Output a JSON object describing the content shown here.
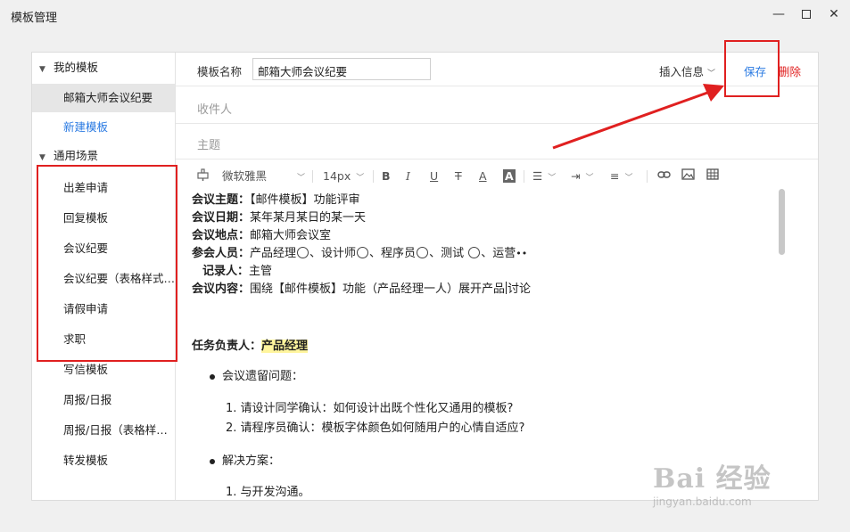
{
  "window": {
    "title": "模板管理"
  },
  "sidebar": {
    "my_templates_header": "我的模板",
    "my_items": [
      {
        "label": "邮箱大师会议纪要"
      },
      {
        "label": "新建模板"
      }
    ],
    "scenes_header": "通用场景",
    "scene_items": [
      {
        "label": "出差申请"
      },
      {
        "label": "回复模板"
      },
      {
        "label": "会议纪要"
      },
      {
        "label": "会议纪要（表格样式…"
      },
      {
        "label": "请假申请"
      },
      {
        "label": "求职"
      },
      {
        "label": "写信模板"
      },
      {
        "label": "周报/日报"
      },
      {
        "label": "周报/日报（表格样…"
      },
      {
        "label": "转发模板"
      }
    ]
  },
  "editor": {
    "name_label": "模板名称",
    "name_value": "邮箱大师会议纪要",
    "insert_label": "插入信息",
    "save_label": "保存",
    "delete_label": "删除",
    "recipient_placeholder": "收件人",
    "subject_placeholder": "主题"
  },
  "toolbar": {
    "font_family": "微软雅黑",
    "font_size": "14px"
  },
  "content": {
    "topic_label": "会议主题：",
    "topic_value": "【邮件模板】功能评审",
    "date_label": "会议日期：",
    "date_value": "某年某月某日的某一天",
    "place_label": "会议地点：",
    "place_value": "邮箱大师会议室",
    "attendees_label": "参会人员：",
    "attendees": [
      "产品经理",
      "、设计师",
      "、程序员",
      "、测试 ",
      "、运营"
    ],
    "recorder_label": "记录人：",
    "recorder_value": "主管",
    "body_label": "会议内容：",
    "body_value_a": "围绕【邮件模板】功能（产品经理一人）展开产品",
    "body_value_b": "讨论",
    "owner_label": "任务负责人：",
    "owner_value": "产品经理",
    "bullet1": "会议遗留问题：",
    "q1": "1. 请设计同学确认：如何设计出既个性化又通用的模板?",
    "q2": "2. 请程序员确认：模板字体颜色如何随用户的心情自适应?",
    "bullet2": "解决方案：",
    "s1": "1. 与开发沟通。"
  },
  "watermark": {
    "main": "Bai  经验",
    "sub": "jingyan.baidu.com"
  },
  "colors": {
    "accent": "#2a7ae2",
    "danger": "#e02020",
    "highlight": "#fff59d"
  }
}
